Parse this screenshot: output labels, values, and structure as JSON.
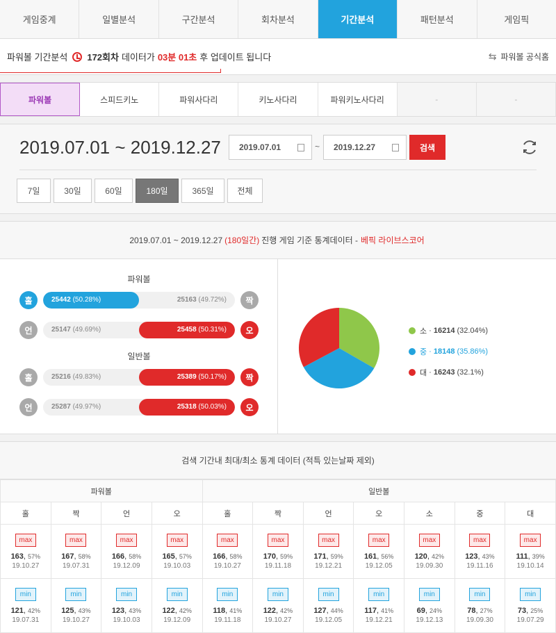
{
  "top_tabs": [
    "게임중계",
    "일별분석",
    "구간분석",
    "회차분석",
    "기간분석",
    "패턴분석",
    "게임픽"
  ],
  "top_active": 4,
  "notice": {
    "prefix": "파워볼 기간분석",
    "round": "172회차",
    "mid": "데이터가",
    "time": "03분 01초",
    "suffix": "후 업데이트 됩니다",
    "home_link": "파워볼 공식홈"
  },
  "sub_tabs": [
    "파워볼",
    "스피드키노",
    "파워사다리",
    "키노사다리",
    "파워키노사다리",
    "-",
    "-"
  ],
  "sub_active": 0,
  "date": {
    "title": "2019.07.01 ~ 2019.12.27",
    "start": "2019.07.01",
    "tilde": "~",
    "end": "2019.12.27",
    "search": "검색",
    "periods": [
      "7일",
      "30일",
      "60일",
      "180일",
      "365일",
      "전체"
    ],
    "period_active": 3
  },
  "stats": {
    "head_range": "2019.07.01 ~ 2019.12.27",
    "head_days": "(180일간)",
    "head_mid": "진행 게임 기준 통계데이터 -",
    "head_source": "베픽 라이브스코어",
    "powerball_title": "파워볼",
    "normal_title": "일반볼",
    "rows": [
      {
        "left_icon": "홀",
        "left_val": "25442",
        "left_pct": "(50.28%)",
        "right_val": "25163",
        "right_pct": "(49.72%)",
        "right_icon": "짝",
        "win": "left",
        "fill_pct": 50.28
      },
      {
        "left_icon": "언",
        "left_val": "25147",
        "left_pct": "(49.69%)",
        "right_val": "25458",
        "right_pct": "(50.31%)",
        "right_icon": "오",
        "win": "right",
        "fill_pct": 50.31
      },
      {
        "left_icon": "홀",
        "left_val": "25216",
        "left_pct": "(49.83%)",
        "right_val": "25389",
        "right_pct": "(50.17%)",
        "right_icon": "짝",
        "win": "right",
        "fill_pct": 50.17
      },
      {
        "left_icon": "언",
        "left_val": "25287",
        "left_pct": "(49.97%)",
        "right_val": "25318",
        "right_pct": "(50.03%)",
        "right_icon": "오",
        "win": "right",
        "fill_pct": 50.03
      }
    ],
    "pie": [
      {
        "label": "소",
        "value": "16214",
        "pct": "(32.04%)",
        "color": "#8fc74a"
      },
      {
        "label": "중",
        "value": "18148",
        "pct": "(35.86%)",
        "color": "#22a3dd"
      },
      {
        "label": "대",
        "value": "16243",
        "pct": "(32.1%)",
        "color": "#e02a2a"
      }
    ]
  },
  "maxmin": {
    "title": "검색 기간내 최대/최소 통계 데이터 (적특 있는날짜 제외)",
    "group_power": "파워볼",
    "group_normal": "일반볼",
    "max_label": "max",
    "min_label": "min",
    "columns": [
      {
        "head": "홀",
        "max": {
          "v": "163",
          "p": "57%",
          "d": "19.10.27"
        },
        "min": {
          "v": "121",
          "p": "42%",
          "d": "19.07.31"
        }
      },
      {
        "head": "짝",
        "max": {
          "v": "167",
          "p": "58%",
          "d": "19.07.31"
        },
        "min": {
          "v": "125",
          "p": "43%",
          "d": "19.10.27"
        }
      },
      {
        "head": "언",
        "max": {
          "v": "166",
          "p": "58%",
          "d": "19.12.09"
        },
        "min": {
          "v": "123",
          "p": "43%",
          "d": "19.10.03"
        }
      },
      {
        "head": "오",
        "max": {
          "v": "165",
          "p": "57%",
          "d": "19.10.03"
        },
        "min": {
          "v": "122",
          "p": "42%",
          "d": "19.12.09"
        }
      },
      {
        "head": "홀",
        "max": {
          "v": "166",
          "p": "58%",
          "d": "19.10.27"
        },
        "min": {
          "v": "118",
          "p": "41%",
          "d": "19.11.18"
        }
      },
      {
        "head": "짝",
        "max": {
          "v": "170",
          "p": "59%",
          "d": "19.11.18"
        },
        "min": {
          "v": "122",
          "p": "42%",
          "d": "19.10.27"
        }
      },
      {
        "head": "언",
        "max": {
          "v": "171",
          "p": "59%",
          "d": "19.12.21"
        },
        "min": {
          "v": "127",
          "p": "44%",
          "d": "19.12.05"
        }
      },
      {
        "head": "오",
        "max": {
          "v": "161",
          "p": "56%",
          "d": "19.12.05"
        },
        "min": {
          "v": "117",
          "p": "41%",
          "d": "19.12.21"
        }
      },
      {
        "head": "소",
        "max": {
          "v": "120",
          "p": "42%",
          "d": "19.09.30"
        },
        "min": {
          "v": "69",
          "p": "24%",
          "d": "19.12.13"
        }
      },
      {
        "head": "중",
        "max": {
          "v": "123",
          "p": "43%",
          "d": "19.11.16"
        },
        "min": {
          "v": "78",
          "p": "27%",
          "d": "19.09.30"
        }
      },
      {
        "head": "대",
        "max": {
          "v": "111",
          "p": "39%",
          "d": "19.10.14"
        },
        "min": {
          "v": "73",
          "p": "25%",
          "d": "19.07.29"
        }
      }
    ]
  }
}
